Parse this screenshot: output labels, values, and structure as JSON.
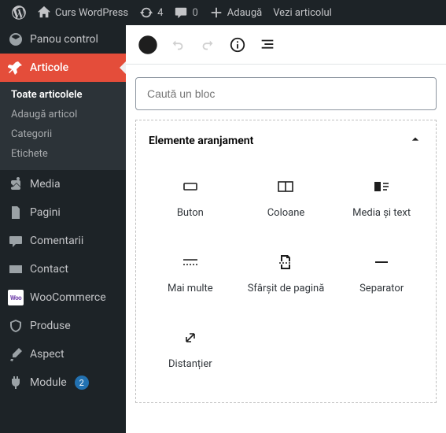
{
  "adminbar": {
    "site_name": "Curs WordPress",
    "updates_count": "4",
    "comments_count": "0",
    "add_label": "Adaugă",
    "view_label": "Vezi articolul"
  },
  "sidebar": {
    "dashboard": "Panou control",
    "posts": "Articole",
    "posts_submenu": {
      "all": "Toate articolele",
      "add": "Adaugă articol",
      "categories": "Categorii",
      "tags": "Etichete"
    },
    "media": "Media",
    "pages": "Pagini",
    "comments": "Comentarii",
    "contact": "Contact",
    "woocommerce": "WooCommerce",
    "products": "Produse",
    "appearance": "Aspect",
    "plugins": "Module",
    "plugins_badge": "2"
  },
  "search": {
    "placeholder": "Caută un bloc"
  },
  "panel": {
    "title": "Elemente aranjament"
  },
  "blocks": {
    "button": "Buton",
    "columns": "Coloane",
    "media_text": "Media și text",
    "more": "Mai multe",
    "page_break": "Sfârșit de pagină",
    "separator": "Separator",
    "spacer": "Distanțier"
  }
}
